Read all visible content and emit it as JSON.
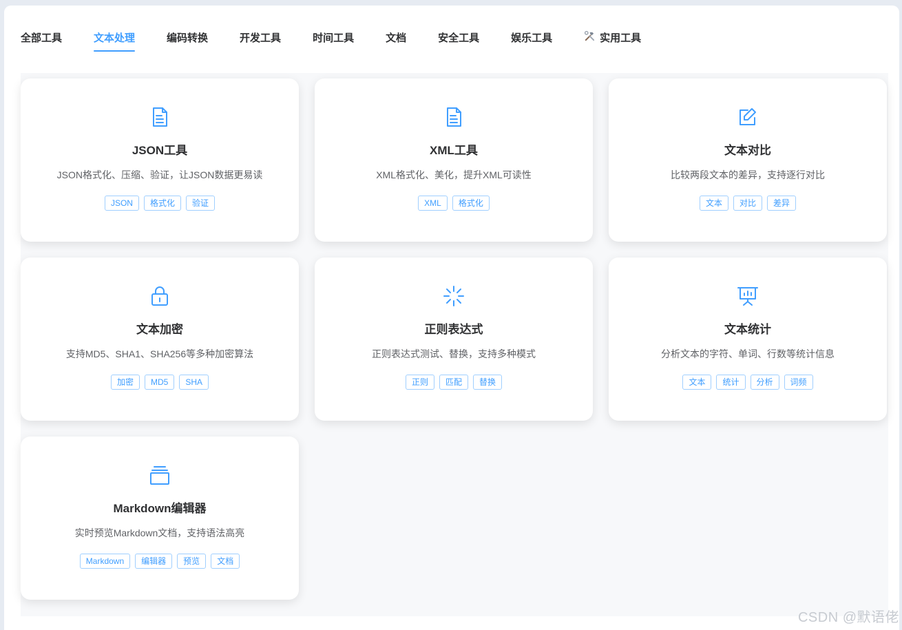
{
  "tabs": [
    {
      "label": "全部工具",
      "active": false
    },
    {
      "label": "文本处理",
      "active": true
    },
    {
      "label": "编码转换",
      "active": false
    },
    {
      "label": "开发工具",
      "active": false
    },
    {
      "label": "时间工具",
      "active": false
    },
    {
      "label": "文档",
      "active": false
    },
    {
      "label": "安全工具",
      "active": false
    },
    {
      "label": "娱乐工具",
      "active": false
    },
    {
      "label": "实用工具",
      "active": false,
      "icon": "hammer-wrench-icon"
    }
  ],
  "cards": [
    {
      "icon": "document-icon",
      "title": "JSON工具",
      "desc": "JSON格式化、压缩、验证，让JSON数据更易读",
      "tags": [
        "JSON",
        "格式化",
        "验证"
      ]
    },
    {
      "icon": "document-icon",
      "title": "XML工具",
      "desc": "XML格式化、美化，提升XML可读性",
      "tags": [
        "XML",
        "格式化"
      ]
    },
    {
      "icon": "edit-icon",
      "title": "文本对比",
      "desc": "比较两段文本的差异，支持逐行对比",
      "tags": [
        "文本",
        "对比",
        "差异"
      ]
    },
    {
      "icon": "lock-icon",
      "title": "文本加密",
      "desc": "支持MD5、SHA1、SHA256等多种加密算法",
      "tags": [
        "加密",
        "MD5",
        "SHA"
      ]
    },
    {
      "icon": "spark-icon",
      "title": "正则表达式",
      "desc": "正则表达式测试、替换，支持多种模式",
      "tags": [
        "正则",
        "匹配",
        "替换"
      ]
    },
    {
      "icon": "presentation-icon",
      "title": "文本统计",
      "desc": "分析文本的字符、单词、行数等统计信息",
      "tags": [
        "文本",
        "统计",
        "分析",
        "词频"
      ]
    },
    {
      "icon": "files-icon",
      "title": "Markdown编辑器",
      "desc": "实时预览Markdown文档，支持语法高亮",
      "tags": [
        "Markdown",
        "编辑器",
        "预览",
        "文档"
      ]
    }
  ],
  "watermark": "CSDN @默语佬",
  "colors": {
    "accent": "#409eff",
    "tag_border": "#a0cfff",
    "text": "#303133",
    "muted": "#606266"
  }
}
